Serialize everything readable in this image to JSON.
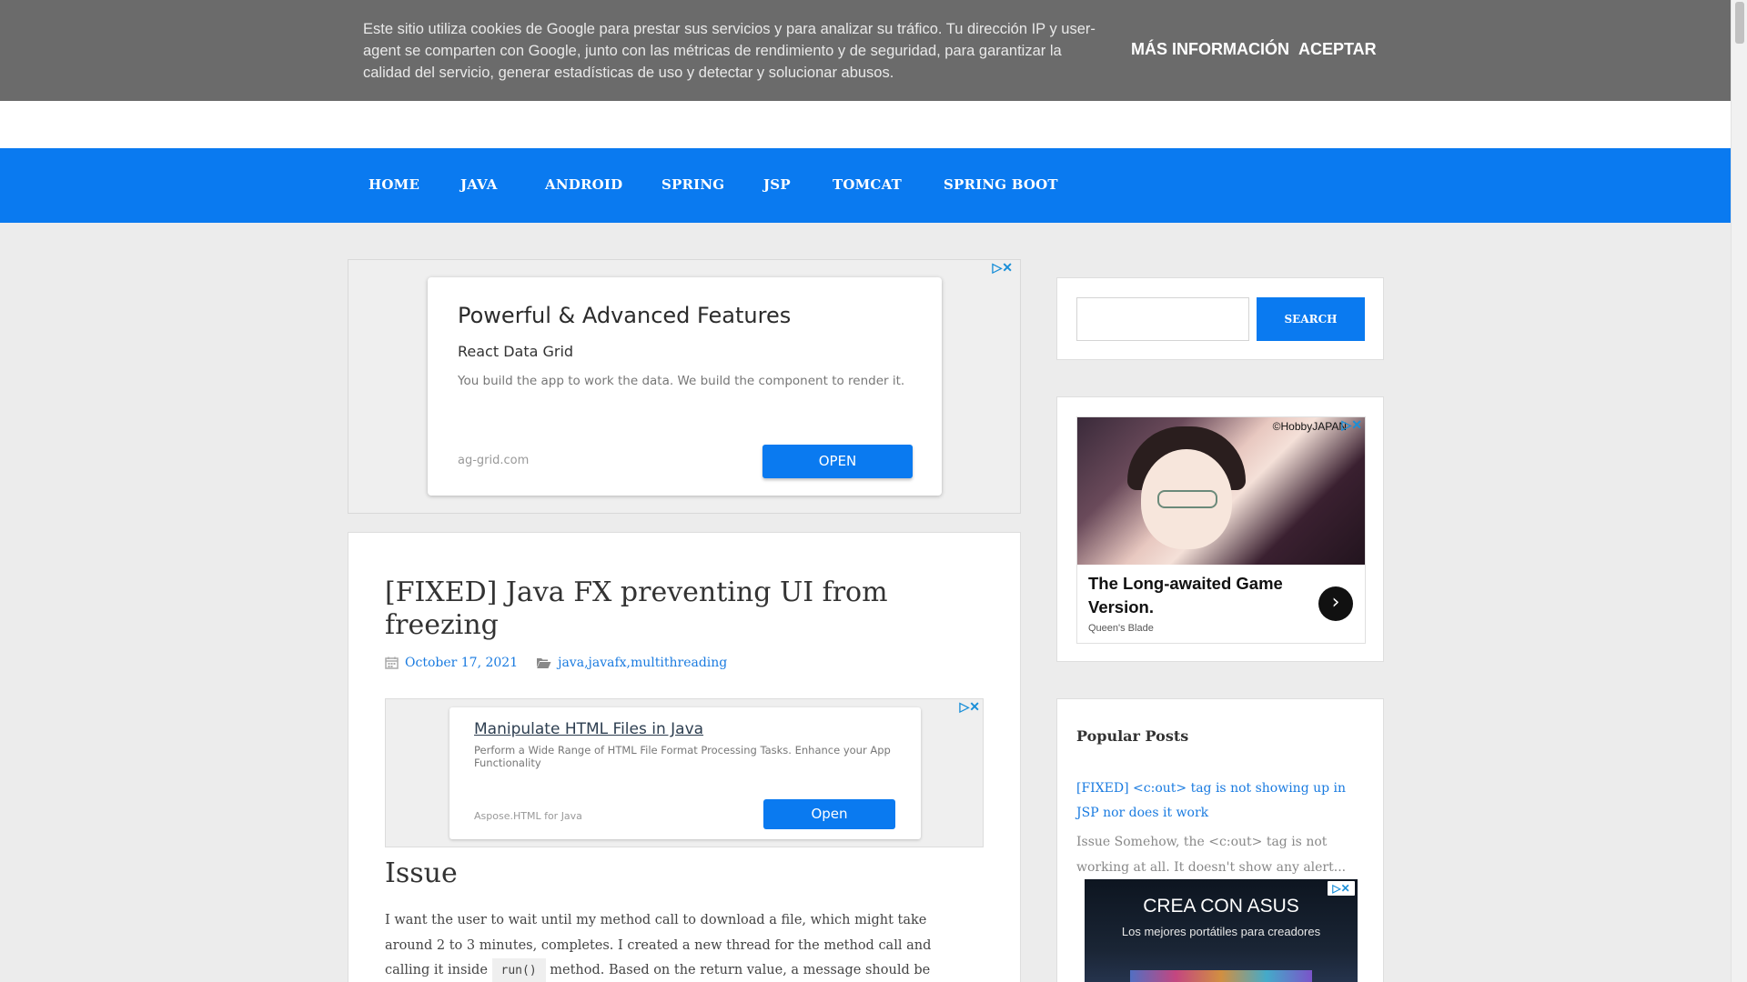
{
  "cookie_banner": {
    "text": "Este sitio utiliza cookies de Google para prestar sus servicios y para analizar su tráfico. Tu dirección IP y user-agent se comparten con Google, junto con las métricas de rendimiento y de seguridad, para garantizar la calidad del servicio, generar estadísticas de uso y detectar y solucionar abusos.",
    "more_info_label": "MÁS INFORMACIÓN",
    "accept_label": "ACEPTAR"
  },
  "nav": {
    "items": [
      {
        "label": "HOME"
      },
      {
        "label": "JAVA"
      },
      {
        "label": "ANDROID"
      },
      {
        "label": "SPRING"
      },
      {
        "label": "JSP"
      },
      {
        "label": "TOMCAT"
      },
      {
        "label": "SPRING BOOT"
      }
    ]
  },
  "top_ad": {
    "title": "Powerful & Advanced Features",
    "subtitle": "React Data Grid",
    "description": "You build the app to work the data. We build the component to render it.",
    "url": "ag-grid.com",
    "button_label": "OPEN",
    "adchoices": "▷✕"
  },
  "post": {
    "title": "[FIXED] Java FX preventing UI from freezing",
    "date": "October 17, 2021",
    "tags": [
      "java",
      "javafx",
      "multithreading"
    ],
    "tag_separator": ", ",
    "inline_ad": {
      "title": "Manipulate HTML Files in Java",
      "description": "Perform a Wide Range of HTML File Format Processing Tasks. Enhance your App Functionality",
      "url": "Aspose.HTML for Java",
      "button_label": "Open",
      "adchoices": "▷✕"
    },
    "issue_heading": "Issue",
    "issue_text_before_code": "I want the user to wait until my method call to download a file, which might take around 2 to 3 minutes, completes. I created a new thread for the method call and calling it inside",
    "code_inline": "run()",
    "issue_text_after_code": "method. Based on the return value, a message should be displayed, whether"
  },
  "sidebar": {
    "search": {
      "placeholder": "",
      "button_label": "SEARCH"
    },
    "game_ad": {
      "copyright": "©HobbyJAPAN",
      "title": "The Long-awaited Game Version.",
      "brand": "Queen's Blade",
      "adchoices": "▷✕",
      "arrow": "›"
    },
    "popular_posts": {
      "heading": "Popular Posts",
      "items": [
        {
          "title": "[FIXED] <c:out> tag is not showing up in JSP nor does it work",
          "excerpt": "Issue Somehow, the <c:out> tag is not working at all. It doesn't show any alert..."
        }
      ]
    },
    "asus_ad": {
      "title": "CREA CON ASUS",
      "subtitle": "Los mejores portátiles para creadores",
      "adchoices": "▷✕"
    }
  },
  "colors": {
    "accent": "#0a7af0",
    "cookie_bg": "#6b6b6b",
    "link": "#1a7be0",
    "page_bg": "#ececec"
  }
}
